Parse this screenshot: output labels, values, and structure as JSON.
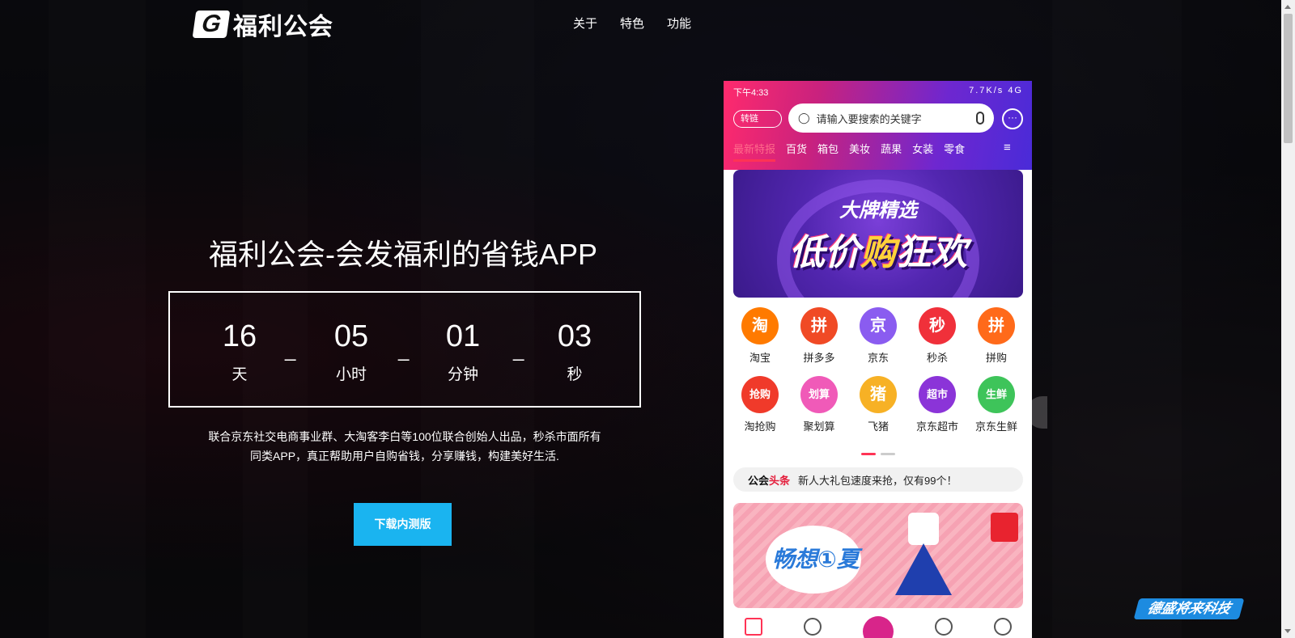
{
  "header": {
    "logo_mark": "G",
    "logo_text": "福利公会",
    "nav": [
      "关于",
      "特色",
      "功能"
    ]
  },
  "hero": {
    "title": "福利公会-会发福利的省钱APP",
    "countdown": [
      {
        "value": "16",
        "label": "天"
      },
      {
        "value": "05",
        "label": "小时"
      },
      {
        "value": "01",
        "label": "分钟"
      },
      {
        "value": "03",
        "label": "秒"
      }
    ],
    "separator": "_",
    "description_line1": "联合京东社交电商事业群、大淘客李白等100位联合创始人出品，秒杀市面所有",
    "description_line2": "同类APP，真正帮助用户自购省钱，分享赚钱，构建美好生活.",
    "download_label": "下载内测版"
  },
  "phone": {
    "status_time": "下午4:33",
    "status_right": "7.7K/s  4G",
    "zhuanlian": "转链",
    "search_placeholder": "请输入要搜索的关键字",
    "categories": [
      "最新特报",
      "百货",
      "箱包",
      "美妆",
      "蔬果",
      "女装",
      "零食"
    ],
    "banner_sub": "大牌精选",
    "banner_main_a": "低价",
    "banner_main_b": "购",
    "banner_main_c": "狂欢",
    "shortcuts_row1": [
      {
        "label": "淘宝",
        "glyph": "淘",
        "color": "#ff7a00"
      },
      {
        "label": "拼多多",
        "glyph": "拼",
        "color": "#f04a25"
      },
      {
        "label": "京东",
        "glyph": "京",
        "color": "#8a5cf0"
      },
      {
        "label": "秒杀",
        "glyph": "秒",
        "color": "#f0303a"
      },
      {
        "label": "拼购",
        "glyph": "拼",
        "color": "#ff6a1a"
      }
    ],
    "shortcuts_row2": [
      {
        "label": "淘抢购",
        "glyph": "抢购",
        "color": "#f03a2a"
      },
      {
        "label": "聚划算",
        "glyph": "划算",
        "color": "#f05ab8"
      },
      {
        "label": "飞猪",
        "glyph": "猪",
        "color": "#f7b125"
      },
      {
        "label": "京东超市",
        "glyph": "超市",
        "color": "#8b34d8"
      },
      {
        "label": "京东生鲜",
        "glyph": "生鲜",
        "color": "#3ec45a"
      }
    ],
    "headline_tag_a": "公会",
    "headline_tag_b": "头条",
    "headline_text": "新人大礼包速度来抢，仅有99个！",
    "promo_text": "畅想①夏"
  },
  "watermark": "德盛将来科技"
}
